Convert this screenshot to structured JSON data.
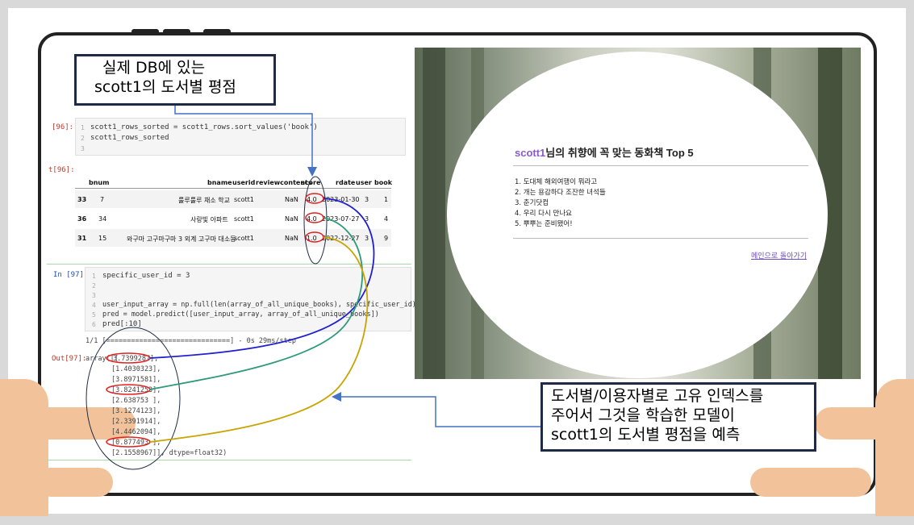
{
  "callouts": {
    "top": [
      "실제 DB에 있는",
      "scott1의 도서별 평점"
    ],
    "bottom": [
      "도서별/이용자별로 고유 인덱스를",
      "주어서 그것을 학습한 모델이",
      "scott1의 도서별 평점을 예측"
    ]
  },
  "notebook": {
    "cell96": {
      "in_prompt": "[96]:",
      "lines": [
        "scott1_rows_sorted = scott1_rows.sort_values('book')",
        "scott1_rows_sorted",
        ""
      ],
      "line_numbers": [
        "1",
        "2",
        "3"
      ]
    },
    "out96_prompt": "t[96]:",
    "table": {
      "columns": [
        "bnum",
        "bname",
        "userid",
        "reviewcontents",
        "score",
        "rdate",
        "user",
        "book"
      ],
      "rows": [
        {
          "index": "33",
          "bnum": "7",
          "bname": "룰루룰루 채소 학교",
          "userid": "scott1",
          "reviewcontents": "NaN",
          "score": "4.0",
          "rdate": "2023-01-30",
          "user": "3",
          "book": "1"
        },
        {
          "index": "36",
          "bnum": "34",
          "bname": "사랑빛 아파트",
          "userid": "scott1",
          "reviewcontents": "NaN",
          "score": "4.0",
          "rdate": "2023-07-27",
          "user": "3",
          "book": "4"
        },
        {
          "index": "31",
          "bnum": "15",
          "bname": "와구마 고구마구마 3 외계 고구마 대소동",
          "userid": "scott1",
          "reviewcontents": "NaN",
          "score": "1.0",
          "rdate": "2022-12-27",
          "user": "3",
          "book": "9"
        }
      ]
    },
    "cell97": {
      "in_prompt": "In [97]:",
      "lines": [
        "specific_user_id = 3",
        "",
        "",
        "user_input_array = np.full(len(array_of_all_unique_books), specific_user_id)",
        "pred = model.predict([user_input_array, array_of_all_unique_books])",
        "pred[:10]"
      ],
      "line_numbers": [
        "1",
        "2",
        "3",
        "4",
        "5",
        "6"
      ]
    },
    "progress": "1/1 [==============================] - 0s 29ms/step",
    "out97_prompt": "Out[97]:",
    "array_prefix": "array([[",
    "array_values": [
      "3.7399287],",
      "[1.4030323],",
      "[3.8971581],",
      "[3.8241253],",
      "[2.638753 ],",
      "[3.1274123],",
      "[2.3391914],",
      "[4.4462094],",
      "[0.877493 ],",
      "[2.1558967]], dtype=float32)"
    ]
  },
  "recommendation": {
    "user": "scott1",
    "title_suffix": "님의 취향에 꼭 맞는 동화책 Top 5",
    "items": [
      "1. 도대체 해외여행이 뭐라고",
      "2. 개는 용감하다 조잔한 녀석들",
      "3. 춘기닷컴",
      "4. 우리 다시 만나요",
      "5. 뿌뿌는 준비됐어!"
    ],
    "back_link": "메인으로 돌아가기"
  },
  "colors": {
    "callout_border": "#1f2b44",
    "arrow": "#4472c4",
    "curve_blue": "#1f1fd0",
    "curve_green": "#2e9a7a",
    "curve_gold": "#c8a400",
    "highlight": "#e02020",
    "username": "#8a5cc9"
  }
}
